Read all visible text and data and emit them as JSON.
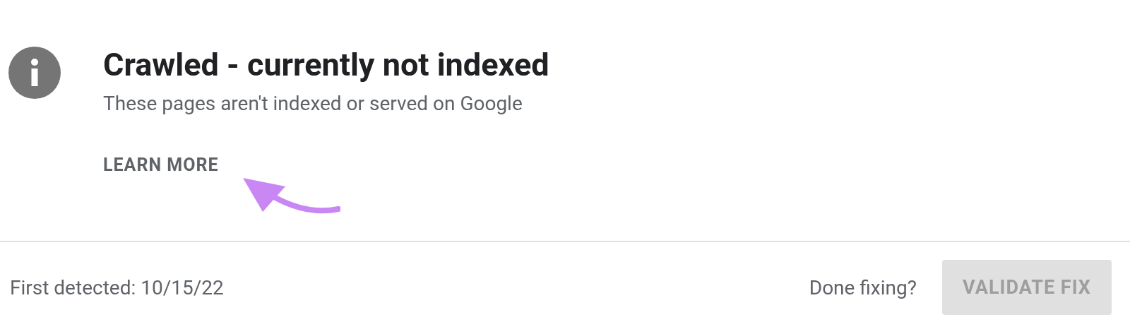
{
  "issue": {
    "title": "Crawled - currently not indexed",
    "description": "These pages aren't indexed or served on Google",
    "link": "LEARN MORE"
  },
  "footer": {
    "first_detected": "First detected: 10/15/22",
    "prompt": "Done fixing?",
    "button": {
      "label": "VALIDATE FIX",
      "disabled": true
    }
  }
}
